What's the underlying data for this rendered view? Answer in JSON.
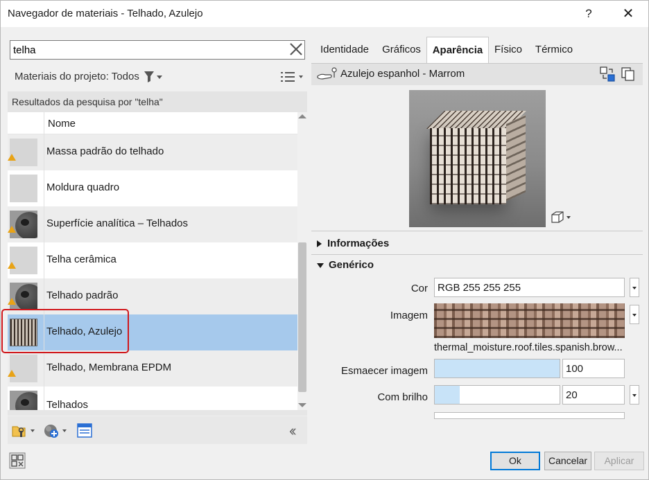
{
  "window": {
    "title": "Navegador de materiais - Telhado, Azulejo",
    "help_label": "?",
    "close_label": "✕"
  },
  "search": {
    "value": "telha",
    "clear_icon": "close-icon"
  },
  "filter": {
    "label": "Materiais do projeto: Todos"
  },
  "results": {
    "header": "Resultados da pesquisa por \"telha\"",
    "column_name": "Nome",
    "items": [
      {
        "label": "Massa padrão do telhado",
        "thumb": "gray",
        "warning": true
      },
      {
        "label": "Moldura quadro",
        "thumb": "gray",
        "warning": false
      },
      {
        "label": "Superfície analítica – Telhados",
        "thumb": "sphere",
        "warning": true
      },
      {
        "label": "Telha cerâmica",
        "thumb": "gray",
        "warning": true
      },
      {
        "label": "Telhado padrão",
        "thumb": "sphere",
        "warning": true
      },
      {
        "label": "Telhado, Azulejo",
        "thumb": "tile",
        "warning": false,
        "selected": true
      },
      {
        "label": "Telhado, Membrana EPDM",
        "thumb": "gray",
        "warning": true
      },
      {
        "label": "Telhados",
        "thumb": "sphere",
        "warning": false
      }
    ]
  },
  "tabs": [
    {
      "label": "Identidade"
    },
    {
      "label": "Gráficos"
    },
    {
      "label": "Aparência",
      "active": true
    },
    {
      "label": "Físico"
    },
    {
      "label": "Térmico"
    }
  ],
  "asset": {
    "name": "Azulejo espanhol - Marrom"
  },
  "sections": {
    "info": "Informações",
    "generic": "Genérico"
  },
  "properties": {
    "cor_label": "Cor",
    "cor_value": "RGB 255 255 255",
    "imagem_label": "Imagem",
    "imagem_file": "thermal_moisture.roof.tiles.spanish.brow...",
    "esmaecer_label": "Esmaecer imagem",
    "esmaecer_value": "100",
    "brilho_label": "Com brilho",
    "brilho_value": "20"
  },
  "buttons": {
    "ok": "Ok",
    "cancel": "Cancelar",
    "apply": "Aplicar"
  },
  "colors": {
    "selection": "#a6c9ec",
    "highlight": "#d0161a",
    "primary_border": "#0078d7",
    "warning": "#e8a317"
  }
}
